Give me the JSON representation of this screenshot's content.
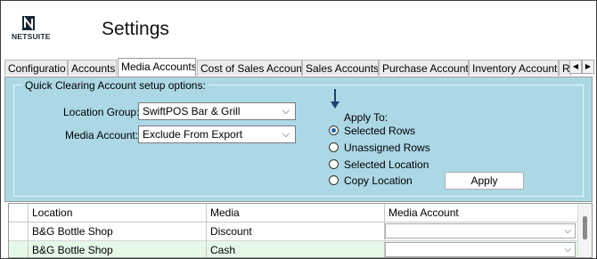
{
  "header": {
    "logo_text": "NETSUITE",
    "title": "Settings"
  },
  "tabs": [
    {
      "label": "Configuratio"
    },
    {
      "label": "Accounts"
    },
    {
      "label": "Media Accounts"
    },
    {
      "label": "Cost of Sales Account"
    },
    {
      "label": "Sales Accounts"
    },
    {
      "label": "Purchase Account"
    },
    {
      "label": "Inventory Accounts"
    },
    {
      "label": "R"
    }
  ],
  "active_tab": "Media Accounts",
  "tab_scroll": {
    "left": "◀",
    "right": "▶"
  },
  "options": {
    "legend": "Quick Clearing Account setup options:",
    "location_group_label": "Location Group:",
    "location_group_value": "SwiftPOS Bar & Grill",
    "media_account_label": "Media Account:",
    "media_account_value": "Exclude From Export",
    "apply_to_label": "Apply To:",
    "radios": [
      {
        "label": "Selected Rows",
        "selected": true
      },
      {
        "label": "Unassigned Rows",
        "selected": false
      },
      {
        "label": "Selected Location",
        "selected": false
      },
      {
        "label": "Copy Location",
        "selected": false
      }
    ],
    "apply_button": "Apply"
  },
  "grid": {
    "columns": [
      "Location",
      "Media",
      "Media Account"
    ],
    "rows": [
      {
        "location": "B&G Bottle Shop",
        "media": "Discount",
        "media_account": ""
      },
      {
        "location": "B&G Bottle Shop",
        "media": "Cash",
        "media_account": ""
      }
    ]
  },
  "colors": {
    "panel": "#acd8e6",
    "row_alt": "#e5f8e5",
    "radio_accent": "#1a5fb4"
  }
}
